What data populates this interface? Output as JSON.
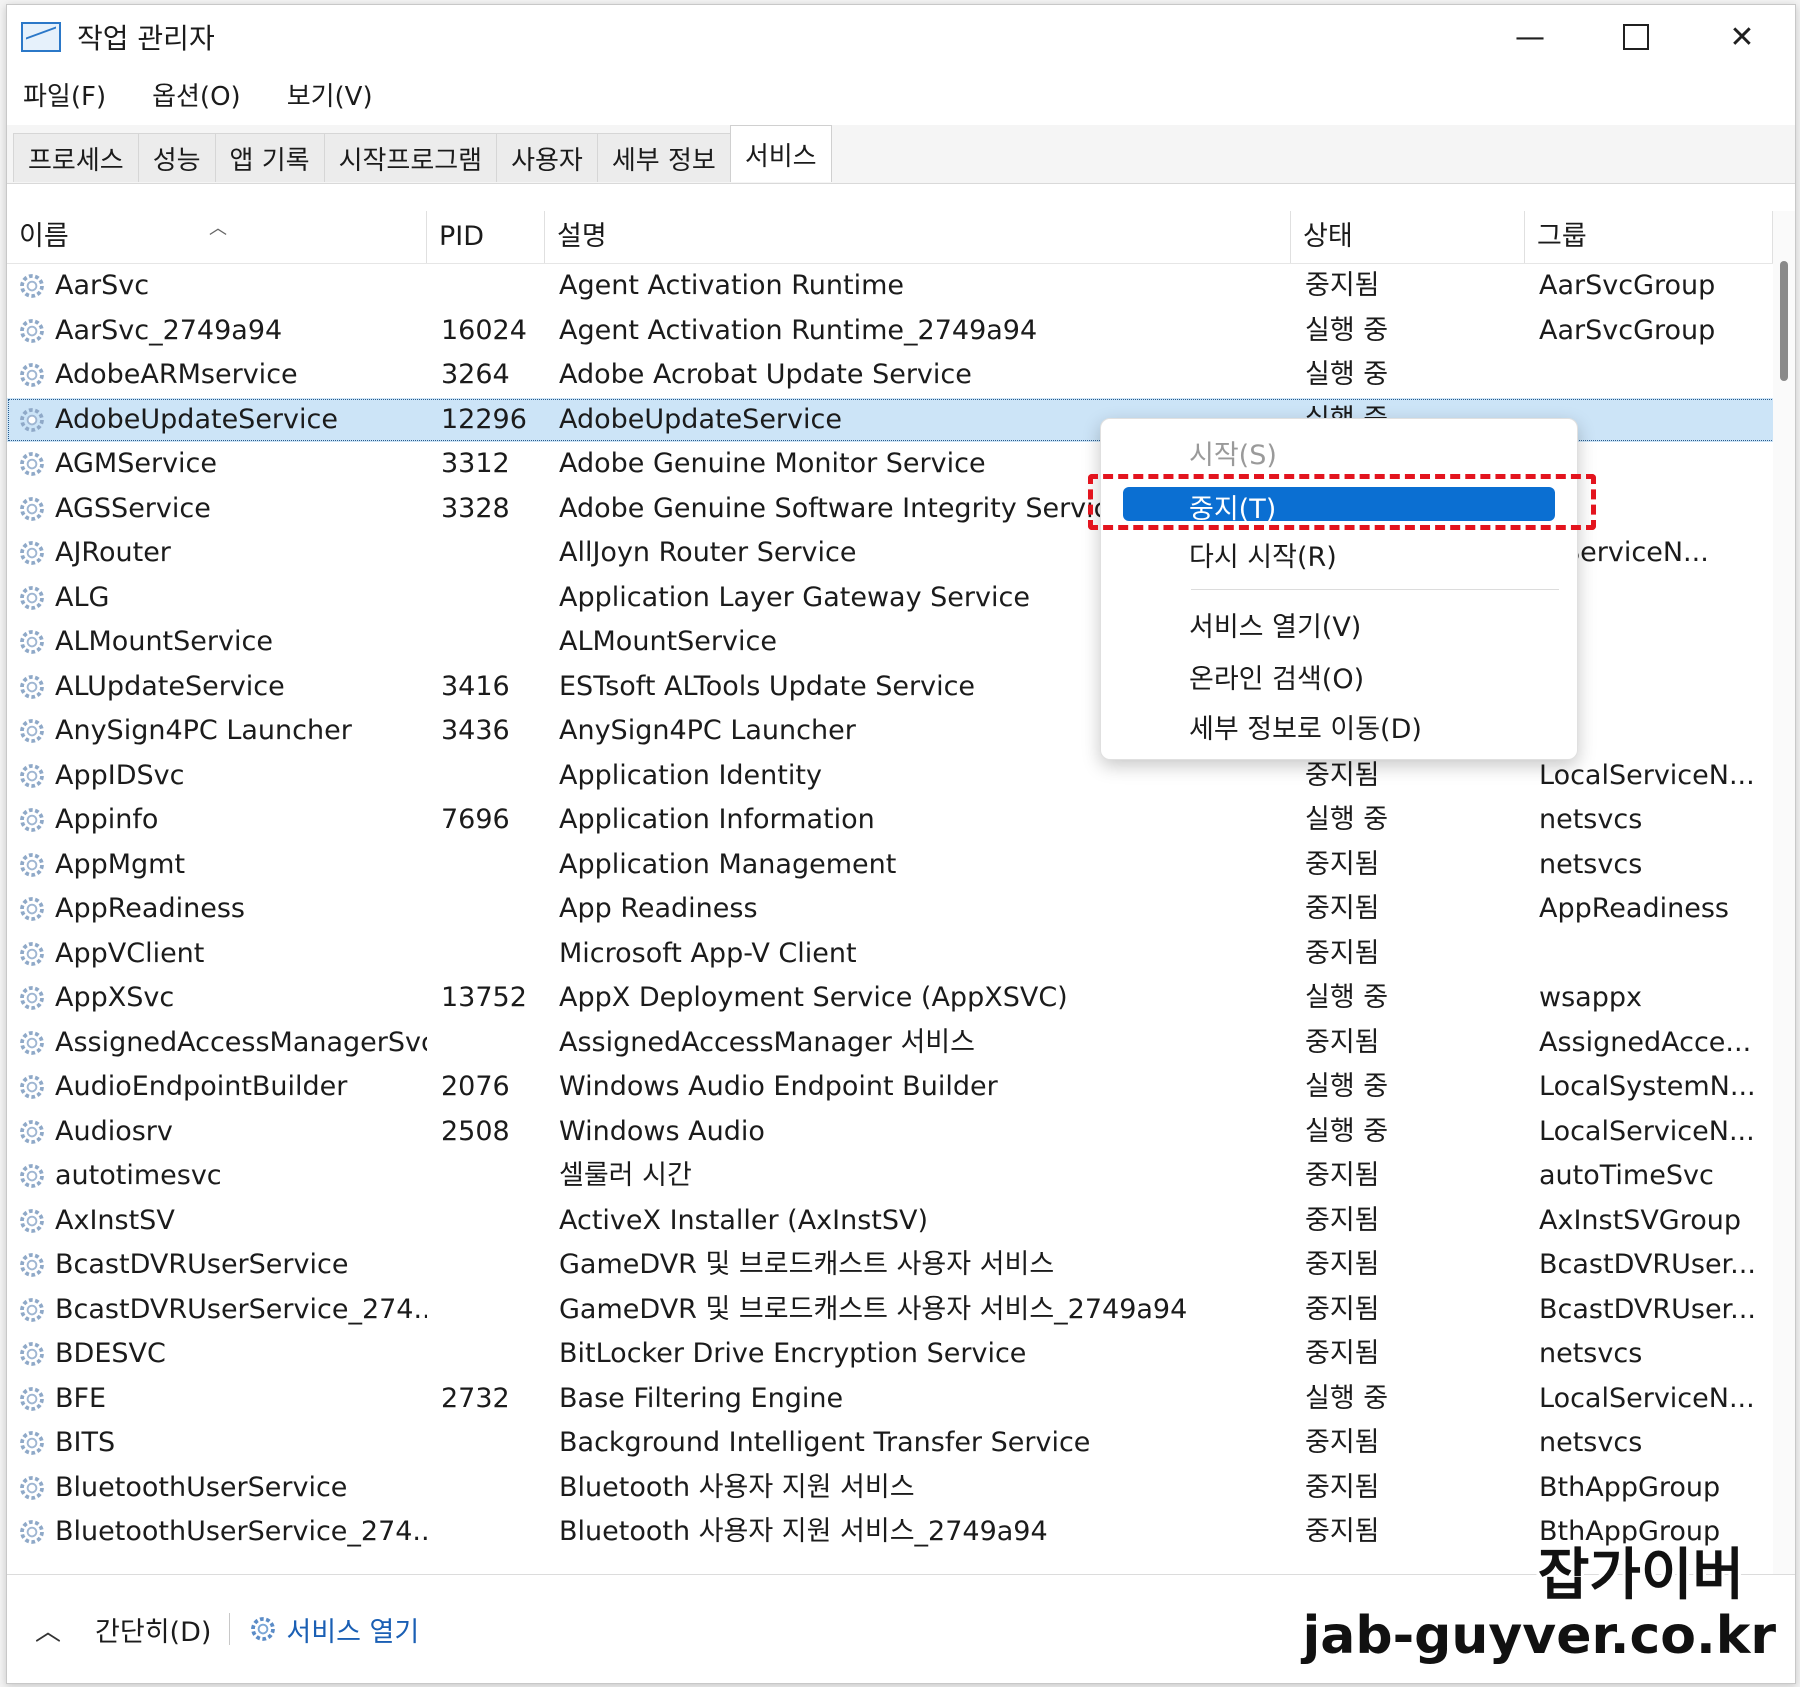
{
  "window": {
    "title": "작업 관리자",
    "minimize": "—",
    "close": "✕"
  },
  "menu": [
    "파일(F)",
    "옵션(O)",
    "보기(V)"
  ],
  "tabs": [
    "프로세스",
    "성능",
    "앱 기록",
    "시작프로그램",
    "사용자",
    "세부 정보",
    "서비스"
  ],
  "active_tab": "서비스",
  "columns": {
    "name": "이름",
    "pid": "PID",
    "desc": "설명",
    "status": "상태",
    "group": "그룹"
  },
  "rows": [
    {
      "name": "AarSvc",
      "pid": "",
      "desc": "Agent Activation Runtime",
      "status": "중지됨",
      "group": "AarSvcGroup"
    },
    {
      "name": "AarSvc_2749a94",
      "pid": "16024",
      "desc": "Agent Activation Runtime_2749a94",
      "status": "실행 중",
      "group": "AarSvcGroup"
    },
    {
      "name": "AdobeARMservice",
      "pid": "3264",
      "desc": "Adobe Acrobat Update Service",
      "status": "실행 중",
      "group": ""
    },
    {
      "name": "AdobeUpdateService",
      "pid": "12296",
      "desc": "AdobeUpdateService",
      "status": "실행 중",
      "group": "",
      "selected": true
    },
    {
      "name": "AGMService",
      "pid": "3312",
      "desc": "Adobe Genuine Monitor Service",
      "status": "",
      "group": ""
    },
    {
      "name": "AGSService",
      "pid": "3328",
      "desc": "Adobe Genuine Software Integrity Service",
      "status": "",
      "group": ""
    },
    {
      "name": "AJRouter",
      "pid": "",
      "desc": "AllJoyn Router Service",
      "status": "",
      "group": "alServiceN..."
    },
    {
      "name": "ALG",
      "pid": "",
      "desc": "Application Layer Gateway Service",
      "status": "",
      "group": ""
    },
    {
      "name": "ALMountService",
      "pid": "",
      "desc": "ALMountService",
      "status": "",
      "group": ""
    },
    {
      "name": "ALUpdateService",
      "pid": "3416",
      "desc": "ESTsoft ALTools Update Service",
      "status": "",
      "group": ""
    },
    {
      "name": "AnySign4PC Launcher",
      "pid": "3436",
      "desc": "AnySign4PC Launcher",
      "status": "",
      "group": ""
    },
    {
      "name": "AppIDSvc",
      "pid": "",
      "desc": "Application Identity",
      "status": "중지됨",
      "group": "LocalServiceN..."
    },
    {
      "name": "Appinfo",
      "pid": "7696",
      "desc": "Application Information",
      "status": "실행 중",
      "group": "netsvcs"
    },
    {
      "name": "AppMgmt",
      "pid": "",
      "desc": "Application Management",
      "status": "중지됨",
      "group": "netsvcs"
    },
    {
      "name": "AppReadiness",
      "pid": "",
      "desc": "App Readiness",
      "status": "중지됨",
      "group": "AppReadiness"
    },
    {
      "name": "AppVClient",
      "pid": "",
      "desc": "Microsoft App-V Client",
      "status": "중지됨",
      "group": ""
    },
    {
      "name": "AppXSvc",
      "pid": "13752",
      "desc": "AppX Deployment Service (AppXSVC)",
      "status": "실행 중",
      "group": "wsappx"
    },
    {
      "name": "AssignedAccessManagerSvc",
      "pid": "",
      "desc": "AssignedAccessManager 서비스",
      "status": "중지됨",
      "group": "AssignedAcce..."
    },
    {
      "name": "AudioEndpointBuilder",
      "pid": "2076",
      "desc": "Windows Audio Endpoint Builder",
      "status": "실행 중",
      "group": "LocalSystemN..."
    },
    {
      "name": "Audiosrv",
      "pid": "2508",
      "desc": "Windows Audio",
      "status": "실행 중",
      "group": "LocalServiceN..."
    },
    {
      "name": "autotimesvc",
      "pid": "",
      "desc": "셀룰러 시간",
      "status": "중지됨",
      "group": "autoTimeSvc"
    },
    {
      "name": "AxInstSV",
      "pid": "",
      "desc": "ActiveX Installer (AxInstSV)",
      "status": "중지됨",
      "group": "AxInstSVGroup"
    },
    {
      "name": "BcastDVRUserService",
      "pid": "",
      "desc": "GameDVR 및 브로드캐스트 사용자 서비스",
      "status": "중지됨",
      "group": "BcastDVRUser..."
    },
    {
      "name": "BcastDVRUserService_274...",
      "pid": "",
      "desc": "GameDVR 및 브로드캐스트 사용자 서비스_2749a94",
      "status": "중지됨",
      "group": "BcastDVRUser..."
    },
    {
      "name": "BDESVC",
      "pid": "",
      "desc": "BitLocker Drive Encryption Service",
      "status": "중지됨",
      "group": "netsvcs"
    },
    {
      "name": "BFE",
      "pid": "2732",
      "desc": "Base Filtering Engine",
      "status": "실행 중",
      "group": "LocalServiceN..."
    },
    {
      "name": "BITS",
      "pid": "",
      "desc": "Background Intelligent Transfer Service",
      "status": "중지됨",
      "group": "netsvcs"
    },
    {
      "name": "BluetoothUserService",
      "pid": "",
      "desc": "Bluetooth 사용자 지원 서비스",
      "status": "중지됨",
      "group": "BthAppGroup"
    },
    {
      "name": "BluetoothUserService_274...",
      "pid": "",
      "desc": "Bluetooth 사용자 지원 서비스_2749a94",
      "status": "중지됨",
      "group": "BthAppGroup"
    }
  ],
  "context_menu": {
    "start": "시작(S)",
    "stop": "중지(T)",
    "restart": "다시 시작(R)",
    "open_services": "서비스 열기(V)",
    "search_online": "온라인 검색(O)",
    "go_details": "세부 정보로 이동(D)"
  },
  "statusbar": {
    "fewer_details": "간단히(D)",
    "open_services": "서비스 열기"
  },
  "watermark": {
    "line1": "잡가이버",
    "line2": "jab-guyver.co.kr"
  },
  "colors": {
    "selection": "#cce4f7",
    "menu_highlight": "#0b6fd2",
    "annotation_red": "#e3141e",
    "link": "#1a5fb4"
  }
}
